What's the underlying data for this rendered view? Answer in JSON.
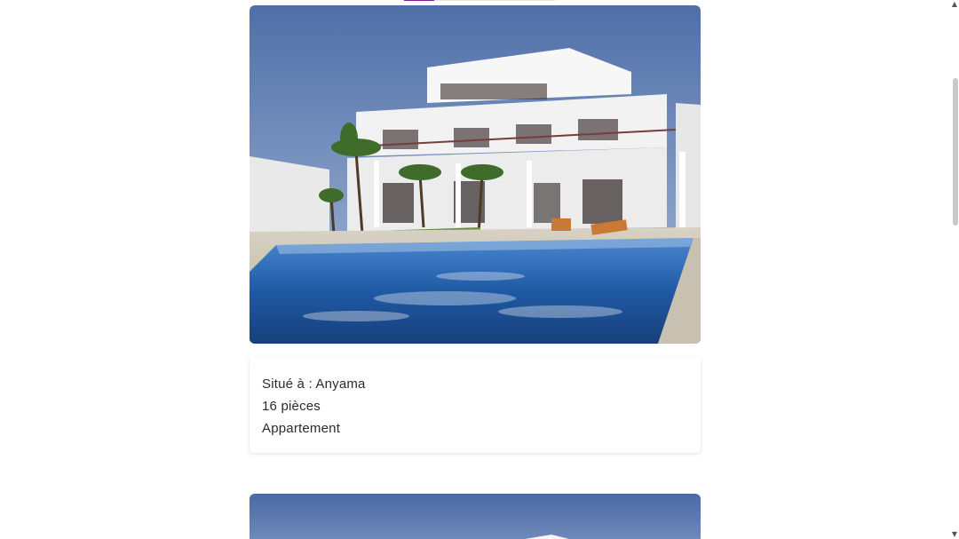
{
  "listing": {
    "location": "Situé à : Anyama",
    "rooms": "16 pièces",
    "type": "Appartement"
  },
  "icons": {
    "scroll_up": "▲",
    "scroll_down": "▼"
  },
  "colors": {
    "accent": "#8a1b8f",
    "sky": "#5f7fb6",
    "pool": "#2d6fc0",
    "building": "#f4f4f4"
  }
}
